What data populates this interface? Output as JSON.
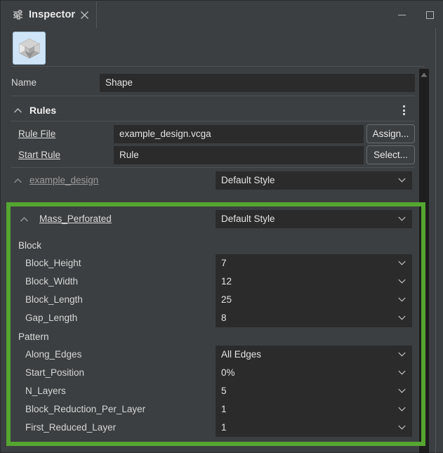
{
  "window": {
    "tab_label": "Inspector",
    "tab_icon": "sliders-icon",
    "close_icon": "close-icon",
    "minimize_icon": "minimize-icon",
    "maximize_icon": "maximize-icon",
    "accent_color": "#55a630",
    "selected_toolbar_bg": "#cfe5f7",
    "panel_bg": "#3c3f41",
    "field_bg": "#2b2b2b"
  },
  "toolbar": {
    "shape_button_icon": "cube-icon"
  },
  "name_row": {
    "label": "Name",
    "value": "Shape"
  },
  "rules_section": {
    "title": "Rules",
    "caret_icon": "chevron-up-icon",
    "menu_icon": "kebab-menu-icon",
    "rule_file": {
      "label": "Rule File",
      "value": "example_design.vcga",
      "button": "Assign..."
    },
    "start_rule": {
      "label": "Start Rule",
      "value": "Rule",
      "button": "Select..."
    }
  },
  "example_design": {
    "label": "example_design",
    "caret_icon": "chevron-up-icon",
    "style": "Default Style"
  },
  "mass_perforated": {
    "label": "Mass_Perforated",
    "caret_icon": "chevron-up-icon",
    "style": "Default Style",
    "groups": [
      {
        "name": "Block",
        "params": [
          {
            "label": "Block_Height",
            "value": "7"
          },
          {
            "label": "Block_Width",
            "value": "12"
          },
          {
            "label": "Block_Length",
            "value": "25"
          },
          {
            "label": "Gap_Length",
            "value": "8"
          }
        ]
      },
      {
        "name": "Pattern",
        "params": [
          {
            "label": "Along_Edges",
            "value": "All Edges"
          },
          {
            "label": "Start_Position",
            "value": "0%"
          },
          {
            "label": "N_Layers",
            "value": "5"
          },
          {
            "label": "Block_Reduction_Per_Layer",
            "value": "1"
          },
          {
            "label": "First_Reduced_Layer",
            "value": "1"
          }
        ]
      }
    ]
  },
  "scrollbar": {
    "up_arrow_icon": "triangle-up-icon"
  }
}
